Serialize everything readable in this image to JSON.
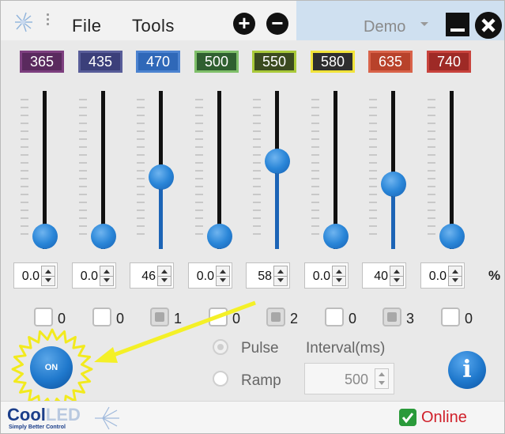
{
  "menu": {
    "file": "File",
    "tools": "Tools",
    "add": "+",
    "remove": "−",
    "profile": "Demo"
  },
  "channels": [
    {
      "wavelength": "365",
      "color": "#5a2a5e",
      "border": "#7d3f7f",
      "value": "0.0",
      "level": 0,
      "group": "0",
      "checked": false
    },
    {
      "wavelength": "435",
      "color": "#3b3f7a",
      "border": "#585d99",
      "value": "0.0",
      "level": 0,
      "group": "0",
      "checked": false
    },
    {
      "wavelength": "470",
      "color": "#2f68b8",
      "border": "#4c83d0",
      "value": "46",
      "level": 46,
      "group": "1",
      "checked": true
    },
    {
      "wavelength": "500",
      "color": "#2f5f30",
      "border": "#7fbf6a",
      "value": "0.0",
      "level": 0,
      "group": "0",
      "checked": false
    },
    {
      "wavelength": "550",
      "color": "#3b4a1f",
      "border": "#a9c93a",
      "value": "58",
      "level": 58,
      "group": "2",
      "checked": true
    },
    {
      "wavelength": "580",
      "color": "#2e2e2e",
      "border": "#f1e33a",
      "value": "0.0",
      "level": 0,
      "group": "0",
      "checked": false
    },
    {
      "wavelength": "635",
      "color": "#b8422b",
      "border": "#d9634a",
      "value": "40",
      "level": 40,
      "group": "3",
      "checked": true
    },
    {
      "wavelength": "740",
      "color": "#9e2a26",
      "border": "#c8433d",
      "value": "0.0",
      "level": 0,
      "group": "0",
      "checked": false
    }
  ],
  "unit": "%",
  "power_button": "ON",
  "mode": {
    "pulse": "Pulse",
    "ramp": "Ramp",
    "selected": "pulse"
  },
  "interval": {
    "label": "Interval(ms)",
    "value": "500"
  },
  "info_button": "i",
  "brand": {
    "name_main": "Cool",
    "name_light": "LED",
    "tagline": "Simply Better Control"
  },
  "status": {
    "text": "Online",
    "color": "#d0202a"
  }
}
